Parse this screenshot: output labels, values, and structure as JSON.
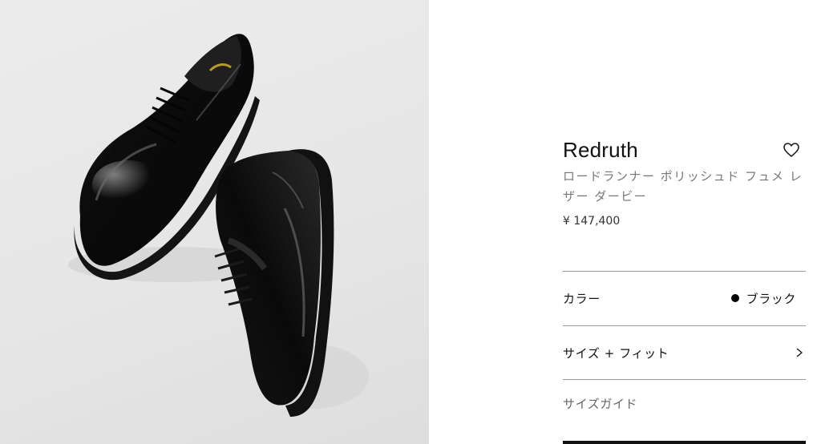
{
  "product": {
    "name": "Redruth",
    "subtitle": "ロードランナー ポリッシュド フュメ レザー ダービー",
    "price": "¥ 147,400"
  },
  "image": {
    "subject": "black-leather-derby-shoes-icon"
  },
  "color_row": {
    "label": "カラー",
    "value": "ブラック",
    "swatch": "#000000"
  },
  "size_row": {
    "label": "サイズ + フィット"
  },
  "size_guide": {
    "label": "サイズガイド"
  },
  "icons": {
    "favorite": "heart-icon",
    "chevron": "chevron-right-icon"
  }
}
